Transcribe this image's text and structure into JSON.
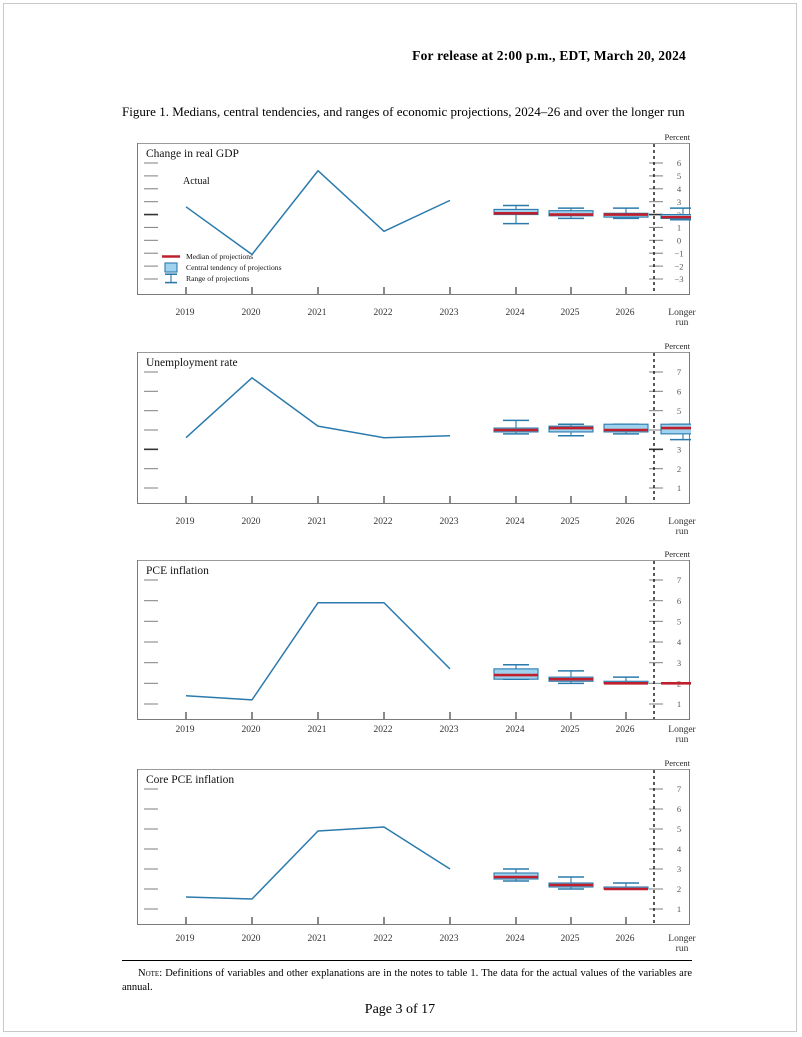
{
  "document": {
    "release_line": "For release at 2:00 p.m., EDT, March 20, 2024",
    "figure_caption": "Figure 1.  Medians, central tendencies, and ranges of economic projections, 2024–26 and over the longer run",
    "note_label": "Note:",
    "note_text": " Definitions of variables and other explanations are in the notes to table 1.  The data for the actual values of the variables are annual.",
    "page_number": "Page 3 of 17"
  },
  "colors": {
    "actual_line": "#2b7aad",
    "median": "#c0202d",
    "central_tendency_fill": "#9fd2ef",
    "central_tendency_edge": "#2b7aad",
    "range_line": "#2b7aad",
    "axis": "#7a7a7a",
    "tick": "#8a8a8a",
    "zero_tick": "#333333",
    "rule": "#9a9a9a",
    "page_border": "#c9c9c9"
  },
  "legend": {
    "actual_label": "Actual",
    "items": [
      {
        "key": "median",
        "label": "Median of projections"
      },
      {
        "key": "central_tendency",
        "label": "Central tendency of projections"
      },
      {
        "key": "range",
        "label": "Range of projections"
      }
    ]
  },
  "axis": {
    "percent_label": "Percent",
    "years": [
      "2019",
      "2020",
      "2021",
      "2022",
      "2023",
      "2024",
      "2025",
      "2026"
    ],
    "longer_run_line1": "Longer",
    "longer_run_line2": "run"
  },
  "chart_data": [
    {
      "id": "change-in-real-gdp",
      "type": "line",
      "title": "Change in real GDP",
      "ylabel": "Percent",
      "ylim": [
        -3,
        6
      ],
      "yticks": [
        6,
        5,
        4,
        3,
        2,
        1,
        0,
        -1,
        -2,
        -3
      ],
      "ytick_labels": [
        "6",
        "5",
        "4",
        "3",
        "2",
        "1",
        "0",
        "−1",
        "−2",
        "−3"
      ],
      "zero_tick": 2,
      "x": [
        "2019",
        "2020",
        "2021",
        "2022",
        "2023"
      ],
      "actual": [
        2.6,
        -1.1,
        5.4,
        0.7,
        3.1
      ],
      "projections": [
        {
          "year": "2024",
          "median": 2.1,
          "ct_low": 2.0,
          "ct_high": 2.4,
          "range_low": 1.3,
          "range_high": 2.7
        },
        {
          "year": "2025",
          "median": 2.0,
          "ct_low": 1.9,
          "ct_high": 2.3,
          "range_low": 1.7,
          "range_high": 2.5
        },
        {
          "year": "2026",
          "median": 2.0,
          "ct_low": 1.8,
          "ct_high": 2.1,
          "range_low": 1.7,
          "range_high": 2.5
        },
        {
          "year": "Longer run",
          "median": 1.8,
          "ct_low": 1.7,
          "ct_high": 2.0,
          "range_low": 1.6,
          "range_high": 2.5
        }
      ]
    },
    {
      "id": "unemployment-rate",
      "type": "line",
      "title": "Unemployment rate",
      "ylabel": "Percent",
      "ylim": [
        1,
        7
      ],
      "yticks": [
        7,
        6,
        5,
        4,
        3,
        2,
        1
      ],
      "ytick_labels": [
        "7",
        "6",
        "5",
        "4",
        "3",
        "2",
        "1"
      ],
      "zero_tick": 3,
      "x": [
        "2019",
        "2020",
        "2021",
        "2022",
        "2023"
      ],
      "actual": [
        3.6,
        6.7,
        4.2,
        3.6,
        3.7
      ],
      "projections": [
        {
          "year": "2024",
          "median": 4.0,
          "ct_low": 3.9,
          "ct_high": 4.1,
          "range_low": 3.8,
          "range_high": 4.5
        },
        {
          "year": "2025",
          "median": 4.1,
          "ct_low": 3.9,
          "ct_high": 4.2,
          "range_low": 3.7,
          "range_high": 4.3
        },
        {
          "year": "2026",
          "median": 4.0,
          "ct_low": 3.9,
          "ct_high": 4.3,
          "range_low": 3.8,
          "range_high": 4.3
        },
        {
          "year": "Longer run",
          "median": 4.1,
          "ct_low": 3.8,
          "ct_high": 4.3,
          "range_low": 3.5,
          "range_high": 4.3
        }
      ]
    },
    {
      "id": "pce-inflation",
      "type": "line",
      "title": "PCE inflation",
      "ylabel": "Percent",
      "ylim": [
        1,
        7
      ],
      "yticks": [
        7,
        6,
        5,
        4,
        3,
        2,
        1
      ],
      "ytick_labels": [
        "7",
        "6",
        "5",
        "4",
        "3",
        "2",
        "1"
      ],
      "zero_tick": null,
      "x": [
        "2019",
        "2020",
        "2021",
        "2022",
        "2023"
      ],
      "actual": [
        1.4,
        1.2,
        5.9,
        5.9,
        2.7
      ],
      "projections": [
        {
          "year": "2024",
          "median": 2.4,
          "ct_low": 2.2,
          "ct_high": 2.7,
          "range_low": 2.2,
          "range_high": 2.9
        },
        {
          "year": "2025",
          "median": 2.2,
          "ct_low": 2.1,
          "ct_high": 2.3,
          "range_low": 2.0,
          "range_high": 2.6
        },
        {
          "year": "2026",
          "median": 2.0,
          "ct_low": 2.0,
          "ct_high": 2.1,
          "range_low": 2.0,
          "range_high": 2.3
        },
        {
          "year": "Longer run",
          "median": 2.0,
          "ct_low": null,
          "ct_high": null,
          "range_low": null,
          "range_high": null
        }
      ]
    },
    {
      "id": "core-pce-inflation",
      "type": "line",
      "title": "Core PCE inflation",
      "ylabel": "Percent",
      "ylim": [
        1,
        7
      ],
      "yticks": [
        7,
        6,
        5,
        4,
        3,
        2,
        1
      ],
      "ytick_labels": [
        "7",
        "6",
        "5",
        "4",
        "3",
        "2",
        "1"
      ],
      "zero_tick": null,
      "x": [
        "2019",
        "2020",
        "2021",
        "2022",
        "2023"
      ],
      "actual": [
        1.6,
        1.5,
        4.9,
        5.1,
        3.0
      ],
      "projections": [
        {
          "year": "2024",
          "median": 2.6,
          "ct_low": 2.5,
          "ct_high": 2.8,
          "range_low": 2.4,
          "range_high": 3.0
        },
        {
          "year": "2025",
          "median": 2.2,
          "ct_low": 2.1,
          "ct_high": 2.3,
          "range_low": 2.0,
          "range_high": 2.6
        },
        {
          "year": "2026",
          "median": 2.0,
          "ct_low": 2.0,
          "ct_high": 2.1,
          "range_low": 2.0,
          "range_high": 2.3
        },
        {
          "year": "Longer run",
          "median": null,
          "ct_low": null,
          "ct_high": null,
          "range_low": null,
          "range_high": null
        }
      ]
    }
  ]
}
